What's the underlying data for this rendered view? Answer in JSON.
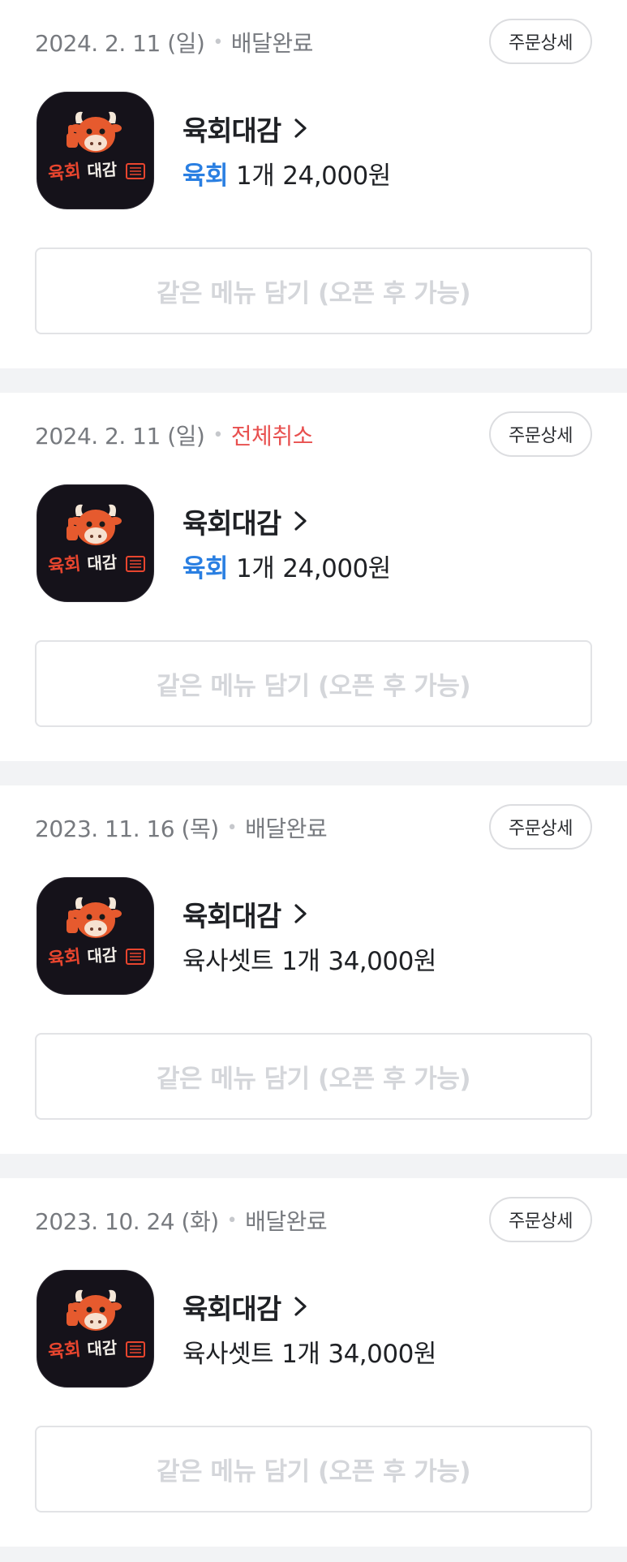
{
  "orders": [
    {
      "date": "2024. 2. 11 (일)",
      "status": "배달완료",
      "status_type": "completed",
      "detail_label": "주문상세",
      "store_name": "육회대감",
      "menu_name": "육회",
      "menu_highlight": true,
      "quantity": "1개",
      "price": "24,000원",
      "reorder_label": "같은 메뉴 담기 (오픈 후 가능)"
    },
    {
      "date": "2024. 2. 11 (일)",
      "status": "전체취소",
      "status_type": "cancelled",
      "detail_label": "주문상세",
      "store_name": "육회대감",
      "menu_name": "육회",
      "menu_highlight": true,
      "quantity": "1개",
      "price": "24,000원",
      "reorder_label": "같은 메뉴 담기 (오픈 후 가능)"
    },
    {
      "date": "2023. 11. 16 (목)",
      "status": "배달완료",
      "status_type": "completed",
      "detail_label": "주문상세",
      "store_name": "육회대감",
      "menu_name": "육사셋트",
      "menu_highlight": false,
      "quantity": "1개",
      "price": "34,000원",
      "reorder_label": "같은 메뉴 담기 (오픈 후 가능)"
    },
    {
      "date": "2023. 10. 24 (화)",
      "status": "배달완료",
      "status_type": "completed",
      "detail_label": "주문상세",
      "store_name": "육회대감",
      "menu_name": "육사셋트",
      "menu_highlight": false,
      "quantity": "1개",
      "price": "34,000원",
      "reorder_label": "같은 메뉴 담기 (오픈 후 가능)"
    }
  ],
  "logo": {
    "text": "육회대감",
    "icon": "bull-mascot-icon",
    "background": "#15121a",
    "text_color": "#e8452e"
  },
  "colors": {
    "highlight_blue": "#2a7fe2",
    "cancel_red": "#e8504f",
    "muted_gray": "#777a7f",
    "disabled_text": "#d4d6da",
    "separator": "#f2f3f5"
  }
}
